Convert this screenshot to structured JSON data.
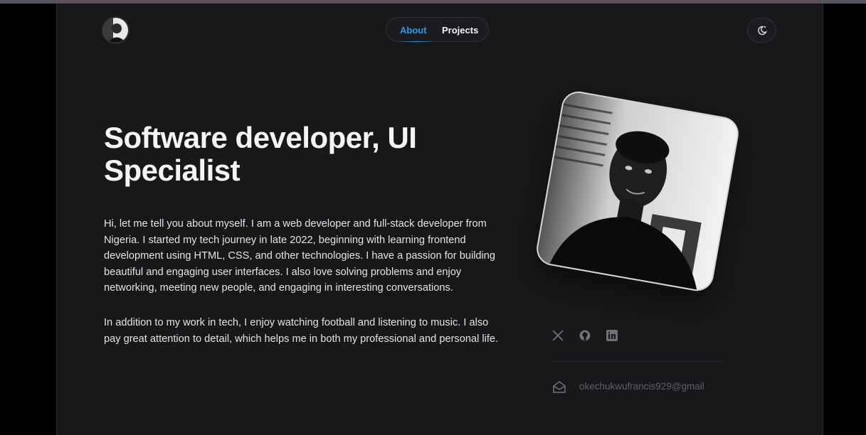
{
  "header": {
    "avatar_icon": "avatar-icon",
    "nav": [
      {
        "label": "About",
        "active": true
      },
      {
        "label": "Projects",
        "active": false
      }
    ],
    "theme_toggle_icon": "moon-sun-icon"
  },
  "hero": {
    "title": "Software developer, UI Specialist",
    "paragraphs": [
      "Hi, let me tell you about myself. I am a web developer and full-stack developer from Nigeria. I started my tech journey in late 2022, beginning with learning frontend development using HTML, CSS, and other technologies. I have a passion for building beautiful and engaging user interfaces. I also love solving problems and enjoy networking, meeting new people, and engaging in interesting conversations.",
      "In addition to my work in tech, I enjoy watching football and listening to music. I also pay great attention to detail, which helps me in both my professional and personal life."
    ]
  },
  "sidebar": {
    "portrait_icon": "portrait-photo-icon",
    "socials": [
      {
        "icon": "x-twitter-icon"
      },
      {
        "icon": "github-icon"
      },
      {
        "icon": "linkedin-icon"
      }
    ],
    "email_icon": "mail-icon",
    "email": "okechukwufrancis929@gmail"
  },
  "colors": {
    "background": "#18181b",
    "accent": "#2d9be3",
    "text": "#f4f4f5",
    "muted": "#5f5f66"
  }
}
